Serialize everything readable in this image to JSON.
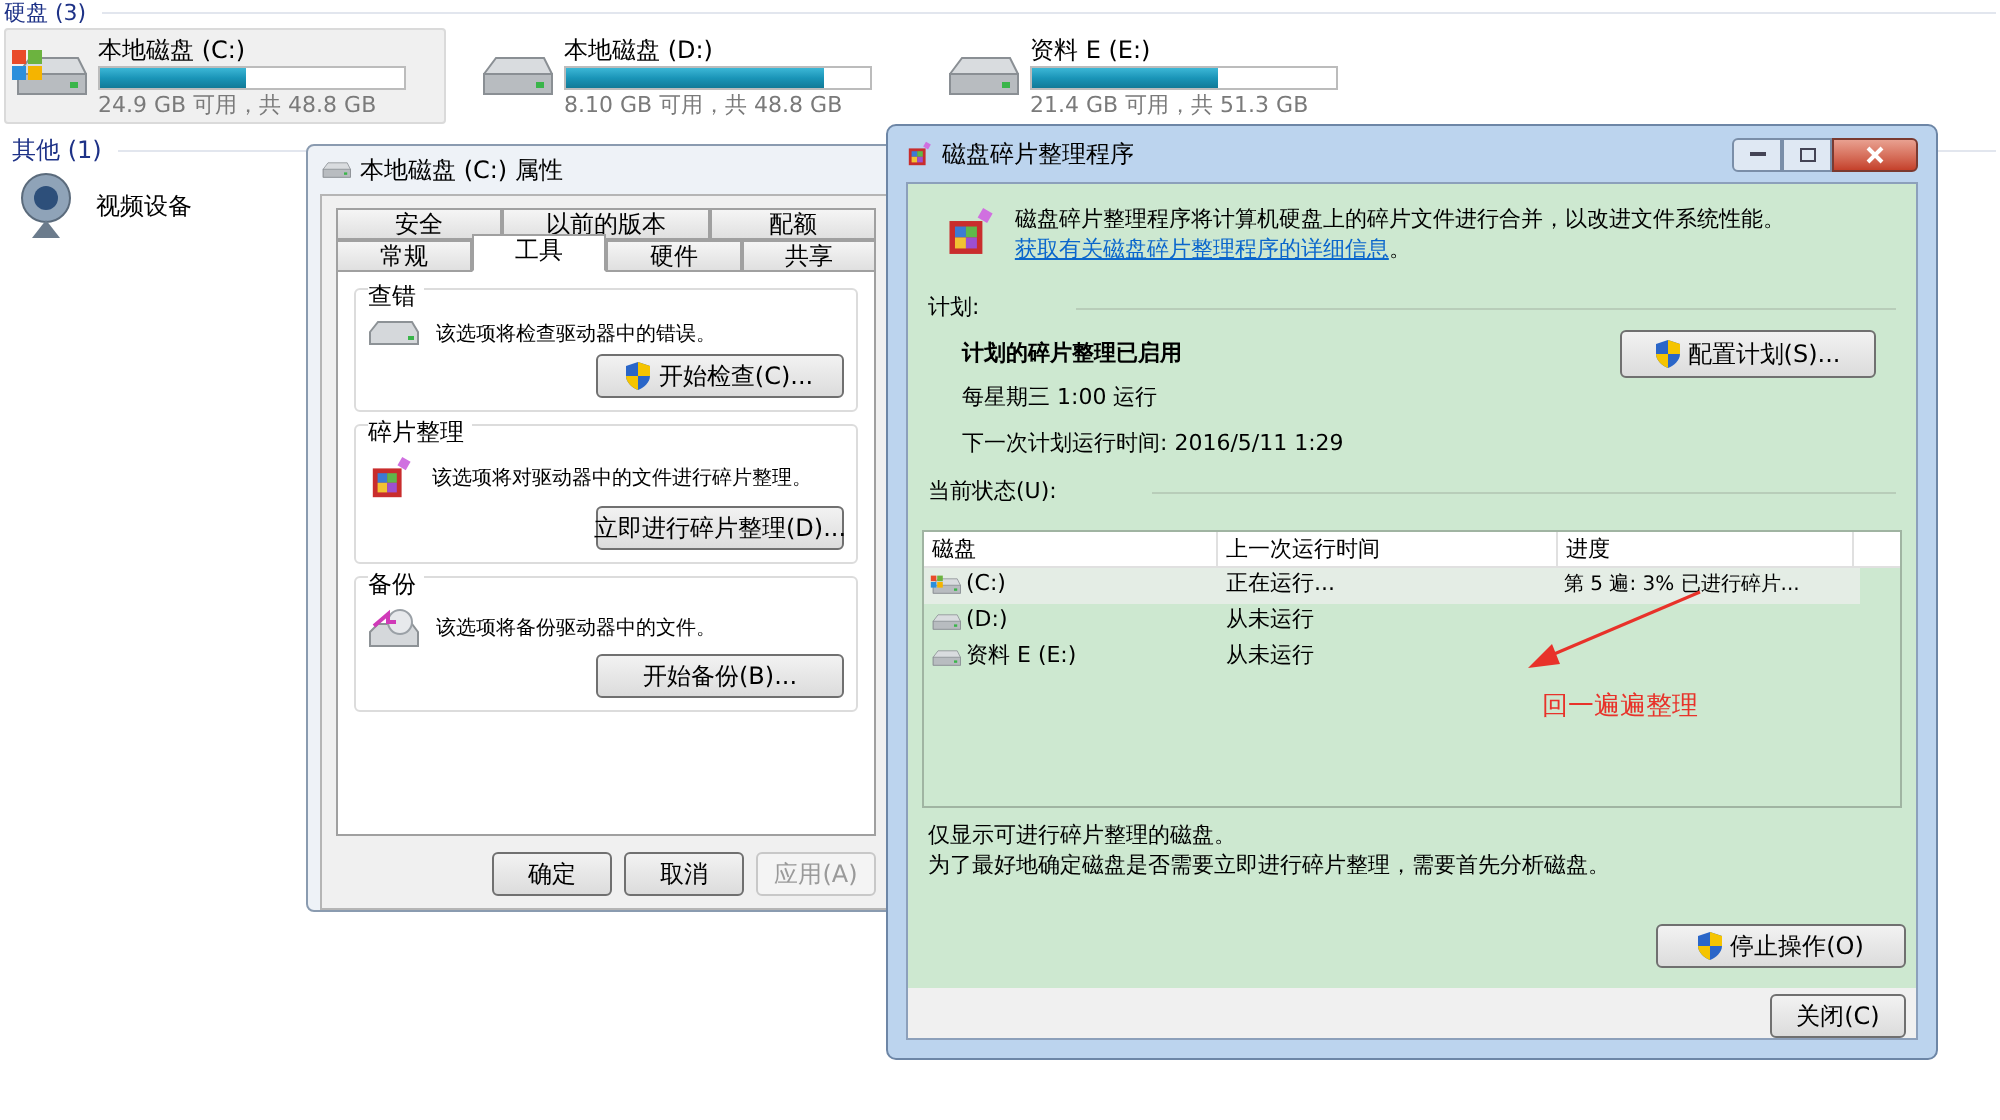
{
  "explorer": {
    "groups": [
      {
        "title": "硬盘 (3)",
        "drives": [
          {
            "name": "本地磁盘 (C:)",
            "level": 0.48,
            "space": "24.9 GB 可用，共 48.8 GB",
            "selected": true,
            "kind": "system"
          },
          {
            "name": "本地磁盘 (D:)",
            "level": 0.85,
            "space": "8.10 GB 可用，共 48.8 GB",
            "selected": false,
            "kind": "disk"
          },
          {
            "name": "资料 E (E:)",
            "level": 0.61,
            "space": "21.4 GB 可用，共 51.3 GB",
            "selected": false,
            "kind": "disk"
          }
        ]
      },
      {
        "title": "其他 (1)",
        "devices": [
          {
            "name": "视频设备"
          }
        ]
      }
    ]
  },
  "properties": {
    "title": "本地磁盘 (C:) 属性",
    "tab_rows": [
      [
        {
          "label": "安全",
          "selected": false
        },
        {
          "label": "以前的版本",
          "selected": false
        },
        {
          "label": "配额",
          "selected": false
        }
      ],
      [
        {
          "label": "常规",
          "selected": false
        },
        {
          "label": "工具",
          "selected": true
        },
        {
          "label": "硬件",
          "selected": false
        },
        {
          "label": "共享",
          "selected": false
        }
      ]
    ],
    "sections": [
      {
        "title": "查错",
        "kind": "check",
        "text": "该选项将检查驱动器中的错误。",
        "button": "开始检查(C)...",
        "shield": true
      },
      {
        "title": "碎片整理",
        "kind": "defrag",
        "text": "该选项将对驱动器中的文件进行碎片整理。",
        "button": "立即进行碎片整理(D)...",
        "shield": false
      },
      {
        "title": "备份",
        "kind": "backup",
        "text": "该选项将备份驱动器中的文件。",
        "button": "开始备份(B)...",
        "shield": false
      }
    ],
    "buttons": [
      {
        "label": "确定",
        "disabled": false
      },
      {
        "label": "取消",
        "disabled": false
      },
      {
        "label": "应用(A)",
        "disabled": true
      }
    ]
  },
  "defrag": {
    "title": "磁盘碎片整理程序",
    "intro": "磁盘碎片整理程序将计算机硬盘上的碎片文件进行合并，以改进文件系统性能。",
    "intro_link": "获取有关磁盘碎片整理程序的详细信息",
    "intro_end": "。",
    "schedule_label": "计划:",
    "schedule_status": "计划的碎片整理已启用",
    "schedule_when": "每星期三  1:00 运行",
    "schedule_next": "下一次计划运行时间: 2016/5/11 1:29",
    "configure_button": "配置计划(S)...",
    "status_label": "当前状态(U):",
    "table": {
      "columns": [
        "磁盘",
        "上一次运行时间",
        "进度"
      ],
      "rows": [
        {
          "disk": "(C:)",
          "last_run": "正在运行...",
          "progress": "第 5 遍: 3% 已进行碎片...",
          "selected": true,
          "kind": "system"
        },
        {
          "disk": "(D:)",
          "last_run": "从未运行",
          "selected": false,
          "kind": "disk"
        },
        {
          "disk": "资料 E (E:)",
          "last_run": "从未运行",
          "selected": false,
          "kind": "disk"
        }
      ]
    },
    "annotation": "回一遍遍整理",
    "notes": [
      "仅显示可进行碎片整理的磁盘。",
      "为了最好地确定磁盘是否需要立即进行碎片整理，需要首先分析磁盘。"
    ],
    "stop_button": "停止操作(O)",
    "close_button": "关闭(C)"
  }
}
